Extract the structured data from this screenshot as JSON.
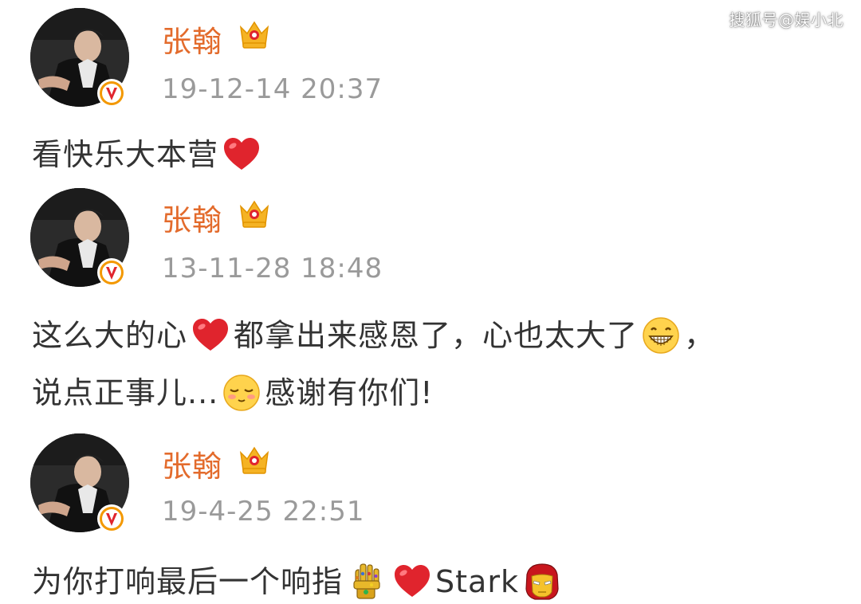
{
  "watermark": "搜狐号@娱小北",
  "colors": {
    "username": "#e36b2c",
    "timestamp": "#9a9a9a",
    "body_text": "#333333",
    "heart": "#e0242d",
    "badge": "#f39800"
  },
  "posts": [
    {
      "username": "张翰",
      "timestamp": "19-12-14 20:37",
      "lines": [
        {
          "segments": [
            "看快乐大本营"
          ],
          "icons": [
            "heart-icon"
          ]
        }
      ]
    },
    {
      "username": "张翰",
      "timestamp": "13-11-28 18:48",
      "lines": [
        {
          "segments": [
            "这么大的心",
            "都拿出来感恩了，心也太大了",
            "，"
          ],
          "icons": [
            "heart-icon",
            "grin-emoji-icon"
          ]
        },
        {
          "segments": [
            "说点正事儿...",
            "感谢有你们!"
          ],
          "icons": [
            "shy-emoji-icon"
          ]
        }
      ]
    },
    {
      "username": "张翰",
      "timestamp": "19-4-25 22:51",
      "lines": [
        {
          "segments": [
            "为你打响最后一个响指",
            "Stark"
          ],
          "icons": [
            "infinity-gauntlet-icon",
            "heart-icon",
            "iron-man-icon"
          ]
        }
      ]
    }
  ]
}
